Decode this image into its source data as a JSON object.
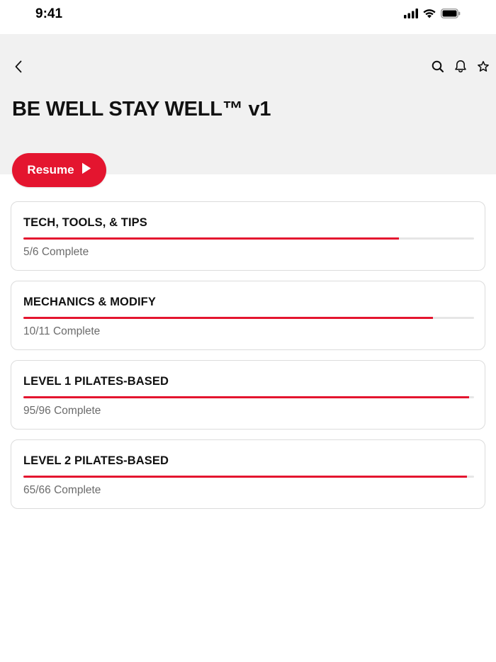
{
  "status_bar": {
    "time": "9:41",
    "icons": [
      "signal-icon",
      "wifi-icon",
      "battery-icon"
    ]
  },
  "header": {
    "back_icon": "chevron-left-icon",
    "actions": [
      "search-icon",
      "bell-icon",
      "star-icon"
    ],
    "title": "BE WELL STAY WELL™ v1"
  },
  "resume": {
    "label": "Resume",
    "icon": "play-icon"
  },
  "courses": [
    {
      "title": "TECH, TOOLS, & TIPS",
      "progress_text": "5/6 Complete",
      "completed": 5,
      "total": 6
    },
    {
      "title": "MECHANICS & MODIFY",
      "progress_text": "10/11 Complete",
      "completed": 10,
      "total": 11
    },
    {
      "title": "LEVEL 1 PILATES-BASED",
      "progress_text": "95/96 Complete",
      "completed": 95,
      "total": 96
    },
    {
      "title": "LEVEL 2 PILATES-BASED",
      "progress_text": "65/66 Complete",
      "completed": 65,
      "total": 66
    }
  ],
  "colors": {
    "accent": "#e4152f",
    "hero_background": "#f1f1f1",
    "muted_text": "#6b6b6b"
  }
}
